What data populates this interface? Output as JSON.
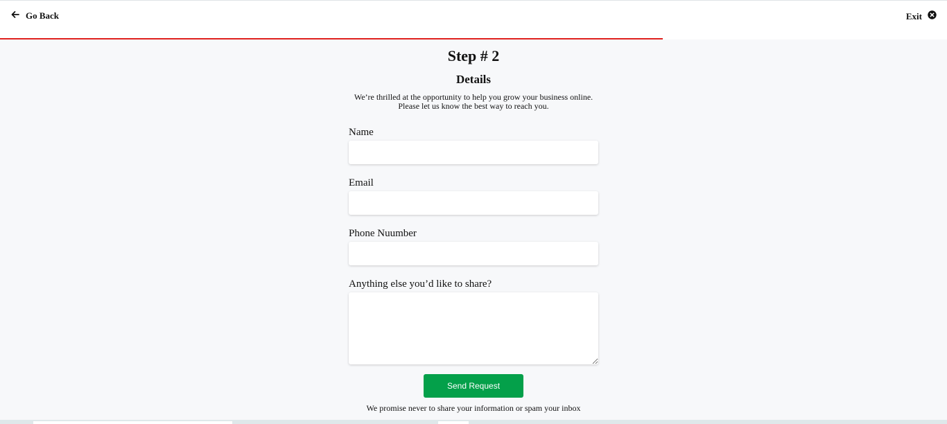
{
  "header": {
    "back_label": "Go Back",
    "exit_label": "Exit",
    "progress_fraction": 0.7,
    "progress_color": "#e0201d"
  },
  "main": {
    "step_title": "Step # 2",
    "section_title": "Details",
    "intro_line1": "We’re thrilled at the opportunity to help you grow your business online.",
    "intro_line2": "Please let us know the best way to reach you."
  },
  "form": {
    "name_label": "Name",
    "name_value": "",
    "email_label": "Email",
    "email_value": "",
    "phone_label": "Phone Nuumber",
    "phone_value": "",
    "message_label": "Anything else you’d like to share?",
    "message_value": "",
    "submit_label": "Send Request",
    "submit_color": "#04a04a",
    "promise_text": "We promise never to share your information or spam your inbox"
  }
}
